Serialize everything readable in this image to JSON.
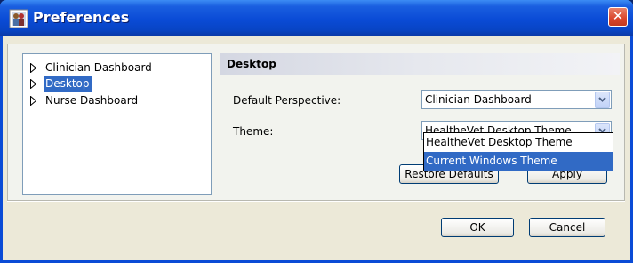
{
  "window": {
    "title": "Preferences",
    "close_glyph": "✕"
  },
  "tree": {
    "items": [
      {
        "label": "Clinician Dashboard",
        "selected": false
      },
      {
        "label": "Desktop",
        "selected": true
      },
      {
        "label": "Nurse Dashboard",
        "selected": false
      }
    ]
  },
  "section": {
    "title": "Desktop"
  },
  "fields": {
    "perspective": {
      "label": "Default Perspective:",
      "value": "Clinician Dashboard"
    },
    "theme": {
      "label": "Theme:",
      "value": "HealtheVet Desktop Theme"
    }
  },
  "theme_dropdown": {
    "options": [
      "HealtheVet Desktop Theme",
      "Current Windows Theme"
    ],
    "highlighted": "Current Windows Theme"
  },
  "buttons": {
    "restore_defaults": "Restore Defaults",
    "apply": "Apply",
    "ok": "OK",
    "cancel": "Cancel"
  },
  "colors": {
    "title_bar": "#0a4bd6",
    "selection": "#316ac5",
    "dialog_bg": "#ece9d8"
  }
}
